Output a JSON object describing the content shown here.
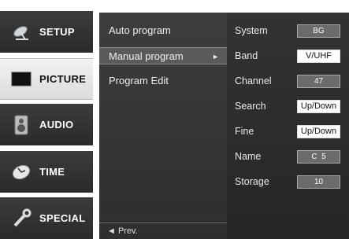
{
  "categories": [
    {
      "label": "SETUP",
      "icon": "satellite-dish-icon"
    },
    {
      "label": "PICTURE",
      "icon": "monitor-icon"
    },
    {
      "label": "AUDIO",
      "icon": "speaker-icon"
    },
    {
      "label": "TIME",
      "icon": "clock-icon"
    },
    {
      "label": "SPECIAL",
      "icon": "wrench-icon"
    }
  ],
  "submenu": {
    "items": [
      {
        "label": "Auto program"
      },
      {
        "label": "Manual program",
        "arrow": "►"
      },
      {
        "label": "Program Edit"
      }
    ],
    "selected_index": 1,
    "prev_label": "◄ Prev."
  },
  "settings": [
    {
      "label": "System",
      "value": "BG"
    },
    {
      "label": "Band",
      "value": "V/UHF"
    },
    {
      "label": "Channel",
      "value": "47"
    },
    {
      "label": "Search",
      "value": "Up/Down"
    },
    {
      "label": "Fine",
      "value": "Up/Down"
    },
    {
      "label": "Name",
      "value": "C  5"
    },
    {
      "label": "Storage",
      "value": "10"
    }
  ]
}
